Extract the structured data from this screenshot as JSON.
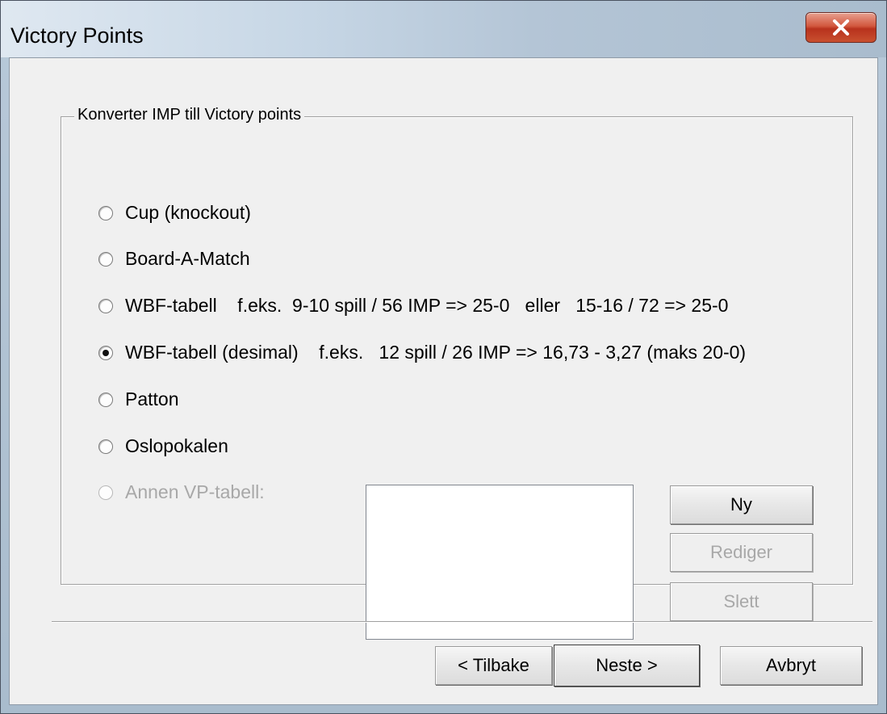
{
  "window": {
    "title": "Victory Points",
    "close_icon": "close-x-icon"
  },
  "group": {
    "legend": "Konverter IMP till Victory points",
    "options": [
      {
        "label": "Cup (knockout)",
        "checked": false,
        "enabled": true
      },
      {
        "label": "Board-A-Match",
        "checked": false,
        "enabled": true
      },
      {
        "label": "WBF-tabell    f.eks.  9-10 spill / 56 IMP => 25-0   eller   15-16 / 72 => 25-0",
        "checked": false,
        "enabled": true
      },
      {
        "label": "WBF-tabell (desimal)    f.eks.   12 spill / 26 IMP => 16,73 - 3,27 (maks 20-0)",
        "checked": true,
        "enabled": true
      },
      {
        "label": "Patton",
        "checked": false,
        "enabled": true
      },
      {
        "label": "Oslopokalen",
        "checked": false,
        "enabled": true
      },
      {
        "label": "Annen VP-tabell:",
        "checked": false,
        "enabled": false
      }
    ],
    "buttons": {
      "new": "Ny",
      "edit": "Rediger",
      "delete": "Slett"
    }
  },
  "footer": {
    "back": "< Tilbake",
    "next": "Neste >",
    "cancel": "Avbryt"
  }
}
